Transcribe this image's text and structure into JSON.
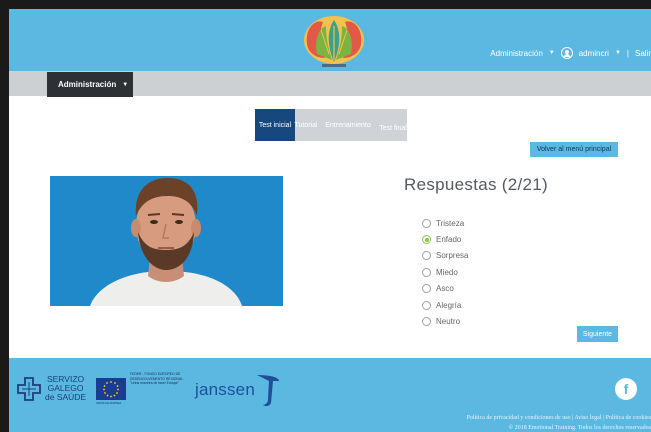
{
  "header": {
    "nav_admin": "Administración",
    "nav_user": "admincri",
    "separator": "|",
    "nav_exit": "Salir"
  },
  "admin_bar": {
    "label": "Administración"
  },
  "steps": [
    {
      "label": "Test inicial",
      "state": "active"
    },
    {
      "label": "Tutorial",
      "state": "inactive"
    },
    {
      "label": "Entrenamiento",
      "state": "inactive"
    },
    {
      "label": "Test final",
      "state": "inactive"
    }
  ],
  "buttons": {
    "menu": "Volver al menú principal",
    "next": "Siguiente"
  },
  "question": {
    "title": "Respuestas (2/21)"
  },
  "options": [
    {
      "label": "Tristeza",
      "checked": false
    },
    {
      "label": "Enfado",
      "checked": true
    },
    {
      "label": "Sorpresa",
      "checked": false
    },
    {
      "label": "Miedo",
      "checked": false
    },
    {
      "label": "Asco",
      "checked": false
    },
    {
      "label": "Alegría",
      "checked": false
    },
    {
      "label": "Neutro",
      "checked": false
    }
  ],
  "footer": {
    "sergas_line1": "SERVIZO",
    "sergas_line2": "GALEGO",
    "sergas_line3": "de SAÚDE",
    "feder_text": "FEDER - FONDO EUROPEO DE DESENVOLVEMENTO REXIONAL. \"Unha maneira de facer Europa\"",
    "eu_label": "UNIÓN EUROPEA",
    "janssen": "janssen",
    "legal": "Política de privacidad y condiciones de uso | Aviso legal | Política de cookies",
    "copyright": "© 2018 Emotional Training. Todos los derechos reservados"
  },
  "colors": {
    "header_blue": "#5ab8e1",
    "dark_navy": "#16477d",
    "admin_bar": "#2d3035",
    "radio_checked": "#8bc34a"
  },
  "icons": [
    "logo-flower-icon",
    "user-circle-icon",
    "caret-down-icon",
    "facebook-icon",
    "sergas-cross-icon",
    "eu-flag-icon",
    "janssen-swoosh-icon"
  ]
}
